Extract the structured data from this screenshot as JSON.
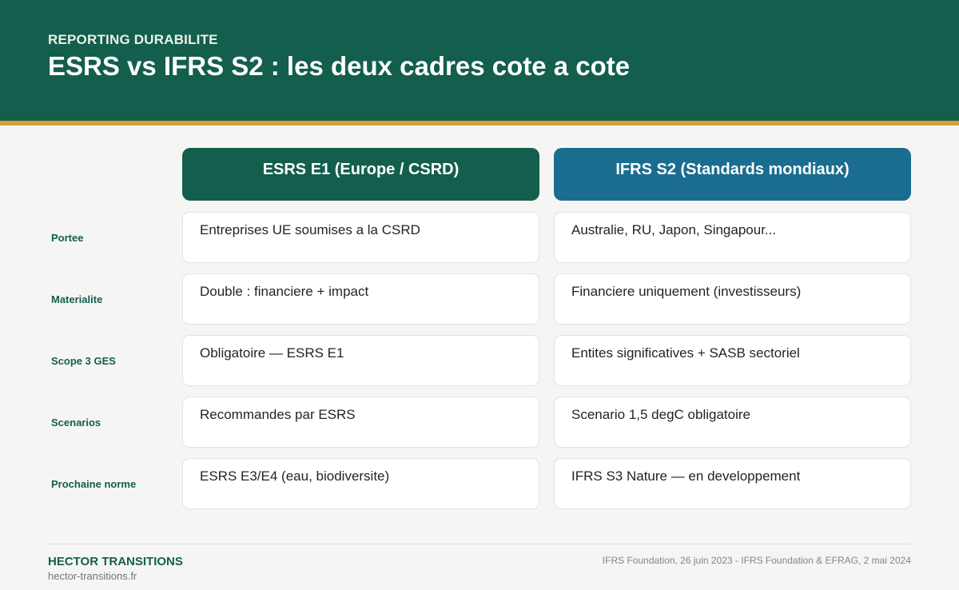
{
  "header": {
    "eyebrow": "REPORTING DURABILITE",
    "title": "ESRS vs IFRS S2 : les deux cadres cote a cote"
  },
  "columns": {
    "esrs": "ESRS E1 (Europe / CSRD)",
    "ifrs": "IFRS S2 (Standards mondiaux)"
  },
  "rows": [
    {
      "label": "Portee",
      "esrs": "Entreprises UE soumises a la CSRD",
      "ifrs": "Australie, RU, Japon, Singapour..."
    },
    {
      "label": "Materialite",
      "esrs": "Double : financiere + impact",
      "ifrs": "Financiere uniquement (investisseurs)"
    },
    {
      "label": "Scope 3 GES",
      "esrs": "Obligatoire — ESRS E1",
      "ifrs": "Entites significatives + SASB sectoriel"
    },
    {
      "label": "Scenarios",
      "esrs": "Recommandes par ESRS",
      "ifrs": "Scenario 1,5 degC obligatoire"
    },
    {
      "label": "Prochaine norme",
      "esrs": "ESRS E3/E4 (eau, biodiversite)",
      "ifrs": "IFRS S3 Nature — en developpement"
    }
  ],
  "footer": {
    "brand": "HECTOR TRANSITIONS",
    "site": "hector-transitions.fr",
    "source": "IFRS Foundation, 26 juin 2023 - IFRS Foundation & EFRAG, 2 mai 2024"
  },
  "colors": {
    "primary": "#135e4d",
    "secondary": "#1b6d8f",
    "accent": "#d4a03a"
  }
}
